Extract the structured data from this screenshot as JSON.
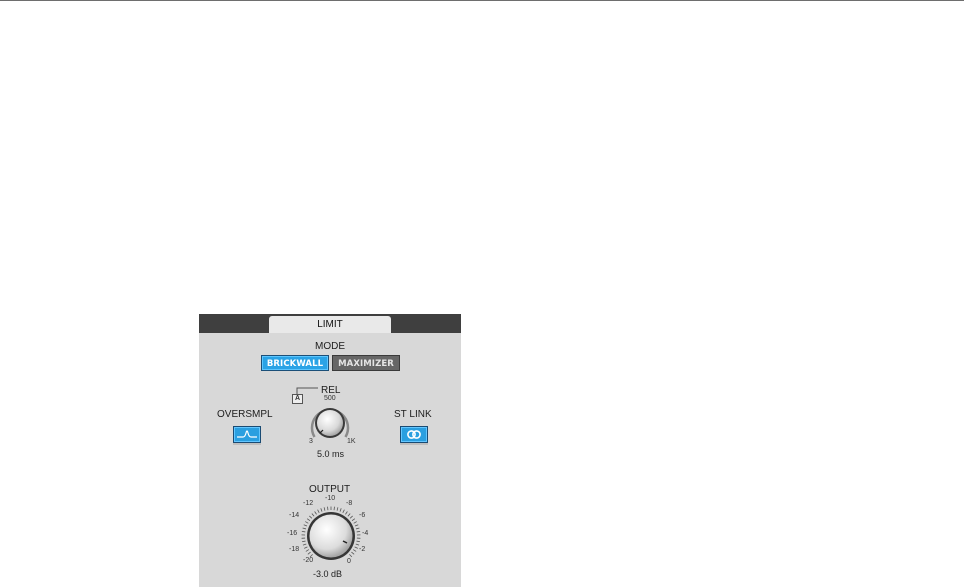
{
  "panel": {
    "tab_label": "LIMIT",
    "mode": {
      "label": "MODE",
      "options": [
        "BRICKWALL",
        "MAXIMIZER"
      ],
      "selected": "BRICKWALL"
    },
    "release": {
      "label": "REL",
      "auto_label": "A",
      "scale_top": "500",
      "scale_min": "3",
      "scale_max": "1K",
      "value": "5.0 ms"
    },
    "oversample": {
      "label": "OVERSMPL",
      "enabled": true,
      "icon": "oversample-waveform-icon"
    },
    "stereo_link": {
      "label": "ST LINK",
      "enabled": true,
      "icon": "stereo-link-icon"
    },
    "output": {
      "label": "OUTPUT",
      "scale": [
        "-20",
        "-18",
        "-16",
        "-14",
        "-12",
        "-10",
        "-8",
        "-6",
        "-4",
        "-2",
        "0"
      ],
      "value": "-3.0 dB"
    }
  },
  "colors": {
    "panel_bg": "#d8d8d8",
    "header_bg": "#3f3f3f",
    "active_blue": "#2aa3e6",
    "inactive_gray": "#666666"
  }
}
